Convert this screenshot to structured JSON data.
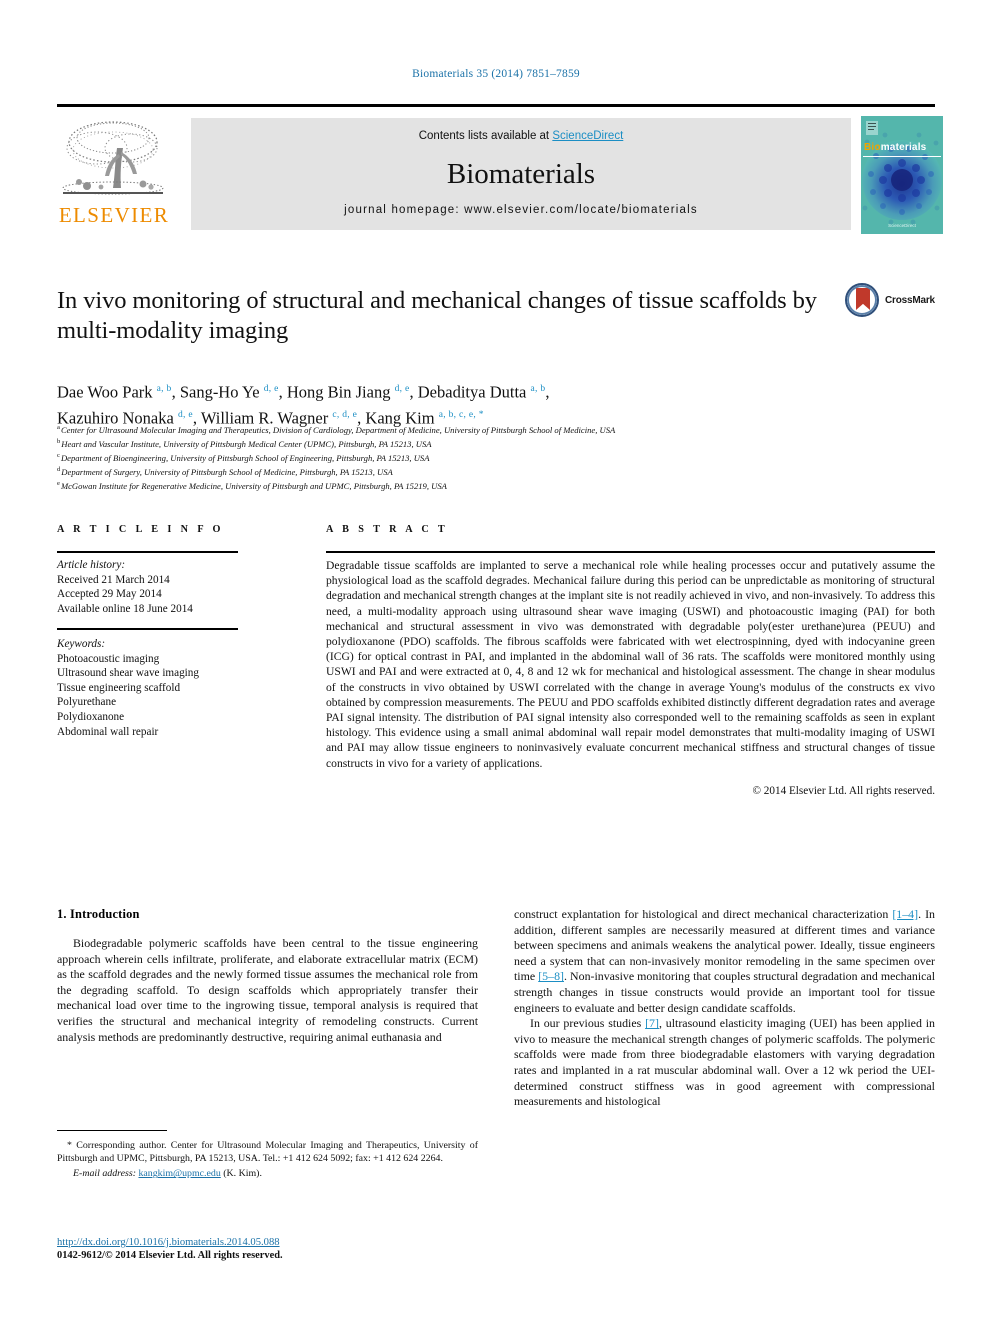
{
  "running_head": "Biomaterials 35 (2014) 7851–7859",
  "masthead": {
    "contents_prefix": "Contents lists available at ",
    "sciencedirect": "ScienceDirect",
    "journal_name": "Biomaterials",
    "homepage": "journal homepage: www.elsevier.com/locate/biomaterials",
    "publisher": "ELSEVIER",
    "cover_title_bio": "Bio",
    "cover_title_rest": "materials",
    "cover_footer": "ScienceDirect"
  },
  "crossmark": {
    "label": "CrossMark"
  },
  "article": {
    "title": "In vivo monitoring of structural and mechanical changes of tissue scaffolds by multi-modality imaging",
    "authors_line1_a": "Dae Woo Park ",
    "authors_line1_a_sup": "a, b",
    "authors_line1_b": ", Sang-Ho Ye ",
    "authors_line1_b_sup": "d, e",
    "authors_line1_c": ", Hong Bin Jiang ",
    "authors_line1_c_sup": "d, e",
    "authors_line1_d": ", Debaditya Dutta ",
    "authors_line1_d_sup": "a, b",
    "authors_line1_end": ",",
    "authors_line2_a": "Kazuhiro Nonaka ",
    "authors_line2_a_sup": "d, e",
    "authors_line2_b": ", William R. Wagner ",
    "authors_line2_b_sup": "c, d, e",
    "authors_line2_c": ", Kang Kim ",
    "authors_line2_c_sup": "a, b, c, e, *",
    "affiliations": [
      {
        "mark": "a",
        "text": "Center for Ultrasound Molecular Imaging and Therapeutics, Division of Cardiology, Department of Medicine, University of Pittsburgh School of Medicine, USA"
      },
      {
        "mark": "b",
        "text": "Heart and Vascular Institute, University of Pittsburgh Medical Center (UPMC), Pittsburgh, PA 15213, USA"
      },
      {
        "mark": "c",
        "text": "Department of Bioengineering, University of Pittsburgh School of Engineering, Pittsburgh, PA 15213, USA"
      },
      {
        "mark": "d",
        "text": "Department of Surgery, University of Pittsburgh School of Medicine, Pittsburgh, PA 15213, USA"
      },
      {
        "mark": "e",
        "text": "McGowan Institute for Regenerative Medicine, University of Pittsburgh and UPMC, Pittsburgh, PA 15219, USA"
      }
    ]
  },
  "headers": {
    "article_info": "A R T I C L E  I N F O",
    "abstract": "A B S T R A C T"
  },
  "article_info": {
    "history_label": "Article history:",
    "received": "Received 21 March 2014",
    "accepted": "Accepted 29 May 2014",
    "available": "Available online 18 June 2014",
    "keywords_label": "Keywords:",
    "keywords": [
      "Photoacoustic imaging",
      "Ultrasound shear wave imaging",
      "Tissue engineering scaffold",
      "Polyurethane",
      "Polydioxanone",
      "Abdominal wall repair"
    ]
  },
  "abstract": {
    "text": "Degradable tissue scaffolds are implanted to serve a mechanical role while healing processes occur and putatively assume the physiological load as the scaffold degrades. Mechanical failure during this period can be unpredictable as monitoring of structural degradation and mechanical strength changes at the implant site is not readily achieved in vivo, and non-invasively. To address this need, a multi-modality approach using ultrasound shear wave imaging (USWI) and photoacoustic imaging (PAI) for both mechanical and structural assessment in vivo was demonstrated with degradable poly(ester urethane)urea (PEUU) and polydioxanone (PDO) scaffolds. The fibrous scaffolds were fabricated with wet electrospinning, dyed with indocyanine green (ICG) for optical contrast in PAI, and implanted in the abdominal wall of 36 rats. The scaffolds were monitored monthly using USWI and PAI and were extracted at 0, 4, 8 and 12 wk for mechanical and histological assessment. The change in shear modulus of the constructs in vivo obtained by USWI correlated with the change in average Young's modulus of the constructs ex vivo obtained by compression measurements. The PEUU and PDO scaffolds exhibited distinctly different degradation rates and average PAI signal intensity. The distribution of PAI signal intensity also corresponded well to the remaining scaffolds as seen in explant histology. This evidence using a small animal abdominal wall repair model demonstrates that multi-modality imaging of USWI and PAI may allow tissue engineers to noninvasively evaluate concurrent mechanical stiffness and structural changes of tissue constructs in vivo for a variety of applications.",
    "copyright": "© 2014 Elsevier Ltd. All rights reserved."
  },
  "introduction": {
    "heading": "1.  Introduction",
    "left_para1_a": "Biodegradable polymeric scaffolds have been central to the tissue engineering approach wherein cells infiltrate, proliferate, and elaborate extracellular matrix (ECM) as the scaffold degrades and the newly formed tissue assumes the mechanical role from the degrading scaffold. To design scaffolds which appropriately transfer their mechanical load over time to the ingrowing tissue, temporal analysis is required that verifies the structural and mechanical integrity of remodeling constructs. Current analysis methods are predominantly destructive, requiring animal euthanasia and",
    "right_para1_a": "construct explantation for histological and direct mechanical characterization ",
    "right_para1_ref1": "[1–4]",
    "right_para1_b": ". In addition, different samples are necessarily measured at different times and variance between specimens and animals weakens the analytical power. Ideally, tissue engineers need a system that can non-invasively monitor remodeling in the same specimen over time ",
    "right_para1_ref2": "[5–8]",
    "right_para1_c": ". Non-invasive monitoring that couples structural degradation and mechanical strength changes in tissue constructs would provide an important tool for tissue engineers to evaluate and better design candidate scaffolds.",
    "right_para2_a": "In our previous studies ",
    "right_para2_ref1": "[7]",
    "right_para2_b": ", ultrasound elasticity imaging (UEI) has been applied in vivo to measure the mechanical strength changes of polymeric scaffolds. The polymeric scaffolds were made from three biodegradable elastomers with varying degradation rates and implanted in a rat muscular abdominal wall. Over a 12 wk period the UEI-determined construct stiffness was in good agreement with compressional measurements and histological"
  },
  "footnote": {
    "star": "*",
    "text": " Corresponding author. Center for Ultrasound Molecular Imaging and Therapeutics, University of Pittsburgh and UPMC, Pittsburgh, PA 15213, USA. Tel.: +1 412 624 5092; fax: +1 412 624 2264.",
    "email_label": "E-mail address:",
    "email": "kangkim@upmc.edu",
    "email_suffix": " (K. Kim)."
  },
  "doi_footer": {
    "doi": "http://dx.doi.org/10.1016/j.biomaterials.2014.05.088",
    "issn": "0142-9612/© 2014 Elsevier Ltd. All rights reserved."
  }
}
